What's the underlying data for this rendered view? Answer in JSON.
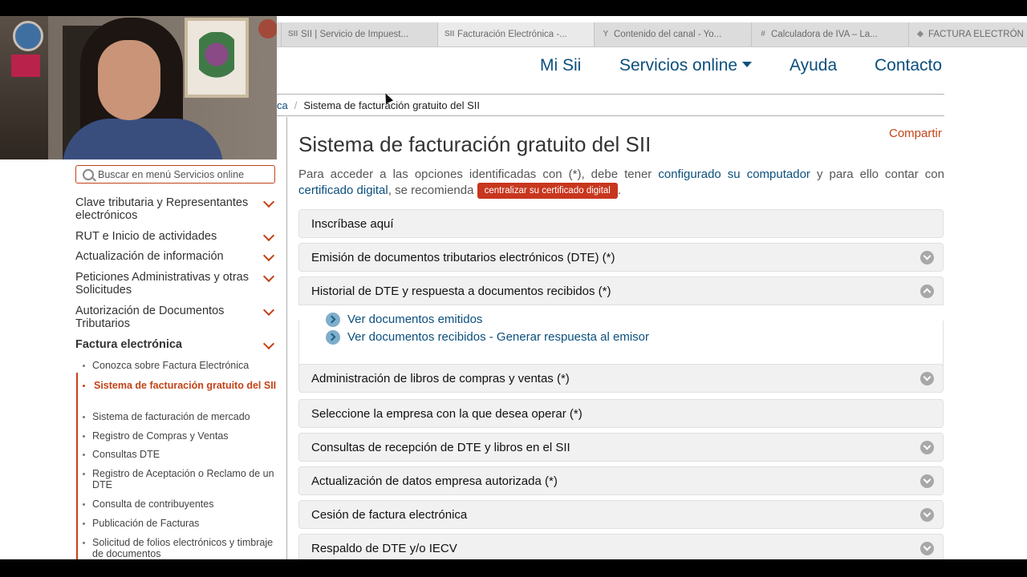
{
  "browser": {
    "tabs": [
      {
        "label": "SII | Servicio de Impuest...",
        "icon": "SII"
      },
      {
        "label": "Facturación Electrónica -...",
        "icon": "SII"
      },
      {
        "label": "Contenido del canal - Yo...",
        "icon": "Y"
      },
      {
        "label": "Calculadora de IVA – La...",
        "icon": "#"
      },
      {
        "label": "FACTURA ELECTRÓN",
        "icon": "◆"
      }
    ]
  },
  "nav": {
    "mi_sii": "Mi Sii",
    "servicios": "Servicios online",
    "ayuda": "Ayuda",
    "contacto": "Contacto"
  },
  "breadcrumb": {
    "prev": "ca",
    "sep": "/",
    "current": "Sistema de facturación gratuito del SII"
  },
  "sidebar": {
    "search_placeholder": "Buscar en menú Servicios online",
    "items": [
      "Clave tributaria y Representantes electrónicos",
      "RUT e Inicio de actividades",
      "Actualización de información",
      "Peticiones Administrativas y otras Solicitudes",
      "Autorización de Documentos Tributarios",
      "Factura electrónica"
    ],
    "subitems": [
      "Conozca sobre Factura Electrónica",
      "Sistema de facturación gratuito del SII",
      "Sistema de facturación de mercado",
      "Registro de Compras y Ventas",
      "Consultas DTE",
      "Registro de Aceptación o Reclamo de un DTE",
      "Consulta de contribuyentes",
      "Publicación de Facturas",
      "Solicitud de folios electrónicos y timbraje de documentos"
    ]
  },
  "main": {
    "share": "Compartir",
    "title": "Sistema de facturación gratuito del SII",
    "intro_1": "Para acceder a las opciones identificadas con (*), debe tener ",
    "intro_link1": "configurado su computador",
    "intro_2": " y para ello contar con ",
    "intro_link2": "certificado digital",
    "intro_3": ", se recomienda ",
    "intro_button": "centralizar su certificado digital",
    "intro_4": ".",
    "accordions": [
      "Inscríbase aquí",
      "Emisión de documentos tributarios electrónicos (DTE) (*)",
      "Historial de DTE y respuesta a documentos recibidos (*)",
      "Administración de libros de compras y ventas (*)",
      "Seleccione la empresa con la que desea operar (*)",
      "Consultas de recepción de DTE y libros en el SII",
      "Actualización de datos empresa autorizada (*)",
      "Cesión de factura electrónica",
      "Respaldo de DTE y/o IECV"
    ],
    "open_links": [
      "Ver documentos emitidos",
      "Ver documentos recibidos - Generar respuesta al emisor"
    ]
  }
}
